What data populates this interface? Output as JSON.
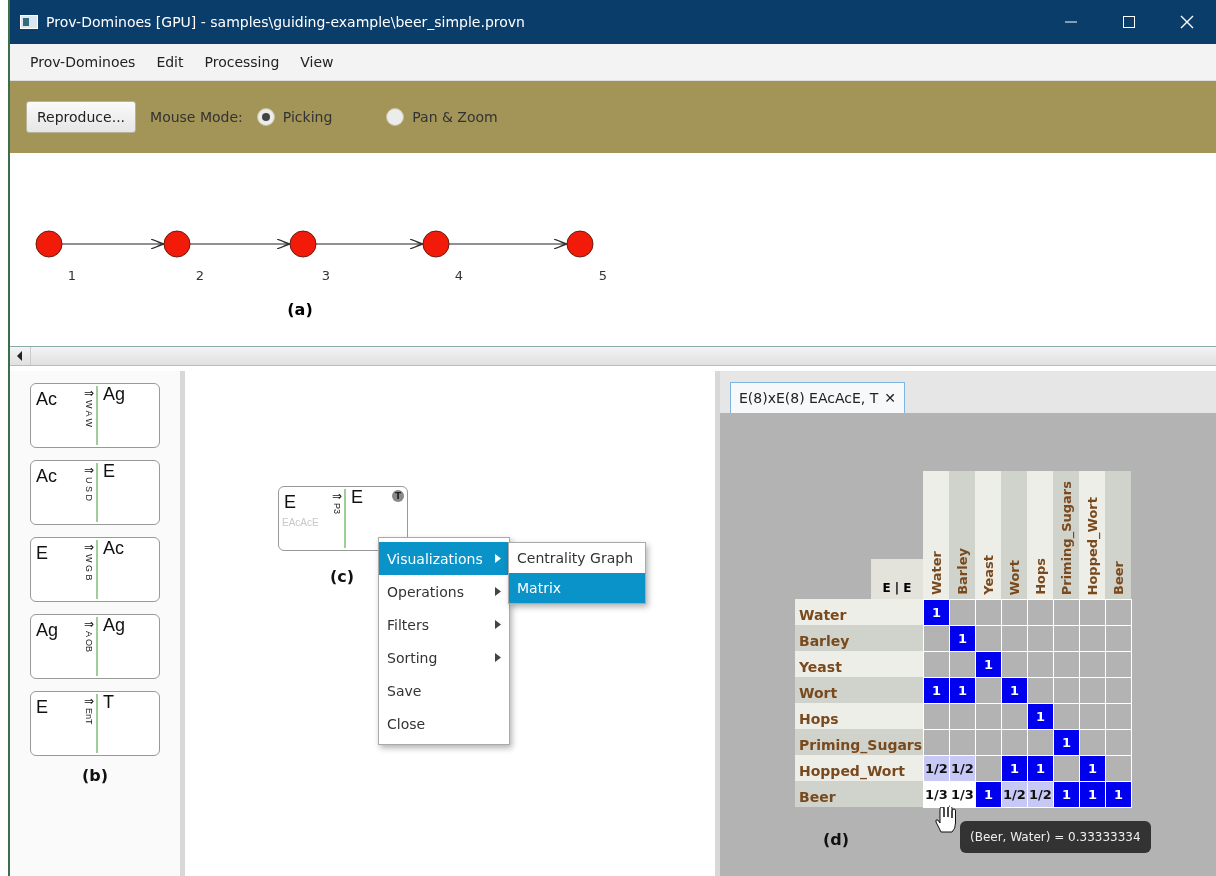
{
  "window": {
    "title": "Prov-Dominoes [GPU] -  samples\\guiding-example\\beer_simple.provn"
  },
  "menu": [
    "Prov-Dominoes",
    "Edit",
    "Processing",
    "View"
  ],
  "toolbar": {
    "button": "Reproduce...",
    "mouse_mode_label": "Mouse Mode:",
    "modes": [
      {
        "label": "Picking",
        "selected": true
      },
      {
        "label": "Pan & Zoom",
        "selected": false
      }
    ]
  },
  "graph": {
    "nodes": [
      "1",
      "2",
      "3",
      "4",
      "5"
    ],
    "caption": "(a)"
  },
  "dominoes": [
    {
      "left": "Ac",
      "arrow": "⇒",
      "relation": "W A W",
      "right": "Ag"
    },
    {
      "left": "Ac",
      "arrow": "⇒",
      "relation": "U S D",
      "right": "E"
    },
    {
      "left": "E",
      "arrow": "⇒",
      "relation": "W G B",
      "right": "Ac"
    },
    {
      "left": "Ag",
      "arrow": "⇒",
      "relation": "A OB",
      "right": "Ag"
    },
    {
      "left": "E",
      "arrow": "⇒",
      "relation": "EnT",
      "right": "T"
    }
  ],
  "dominoes_caption": "(b)",
  "workspace": {
    "domino": {
      "left": "E",
      "arrow": "⇒",
      "right": "E",
      "path": "EAcAcE",
      "relation": "P3",
      "badge": "T"
    },
    "caption": "(c)",
    "context_menu": [
      {
        "label": "Visualizations",
        "submenu": true,
        "selected": true
      },
      {
        "label": "Operations",
        "submenu": true,
        "selected": false
      },
      {
        "label": "Filters",
        "submenu": true,
        "selected": false
      },
      {
        "label": "Sorting",
        "submenu": true,
        "selected": false
      },
      {
        "label": "Save",
        "submenu": false,
        "selected": false
      },
      {
        "label": "Close",
        "submenu": false,
        "selected": false
      }
    ],
    "submenu": [
      {
        "label": "Centrality Graph",
        "selected": false
      },
      {
        "label": "Matrix",
        "selected": true
      }
    ]
  },
  "matrix_view": {
    "tab": {
      "label": "E(8)xE(8) EAcAcE, T",
      "close": "✕"
    },
    "corner": "E | E",
    "columns": [
      "Water",
      "Barley",
      "Yeast",
      "Wort",
      "Hops",
      "Priming_Sugars",
      "Hopped_Wort",
      "Beer"
    ],
    "rows": [
      {
        "label": "Water",
        "cells": [
          {
            "value": "1",
            "kind": "full"
          },
          null,
          null,
          null,
          null,
          null,
          null,
          null
        ]
      },
      {
        "label": "Barley",
        "cells": [
          null,
          {
            "value": "1",
            "kind": "full"
          },
          null,
          null,
          null,
          null,
          null,
          null
        ]
      },
      {
        "label": "Yeast",
        "cells": [
          null,
          null,
          {
            "value": "1",
            "kind": "full"
          },
          null,
          null,
          null,
          null,
          null
        ]
      },
      {
        "label": "Wort",
        "cells": [
          {
            "value": "1",
            "kind": "full"
          },
          {
            "value": "1",
            "kind": "full"
          },
          null,
          {
            "value": "1",
            "kind": "full"
          },
          null,
          null,
          null,
          null
        ]
      },
      {
        "label": "Hops",
        "cells": [
          null,
          null,
          null,
          null,
          {
            "value": "1",
            "kind": "full"
          },
          null,
          null,
          null
        ]
      },
      {
        "label": "Priming_Sugars",
        "cells": [
          null,
          null,
          null,
          null,
          null,
          {
            "value": "1",
            "kind": "full"
          },
          null,
          null
        ]
      },
      {
        "label": "Hopped_Wort",
        "cells": [
          {
            "value": "1/2",
            "kind": "partial"
          },
          {
            "value": "1/2",
            "kind": "partial"
          },
          null,
          {
            "value": "1",
            "kind": "full"
          },
          {
            "value": "1",
            "kind": "full"
          },
          null,
          {
            "value": "1",
            "kind": "full"
          },
          null
        ]
      },
      {
        "label": "Beer",
        "cells": [
          {
            "value": "1/3",
            "kind": "light"
          },
          {
            "value": "1/3",
            "kind": "light"
          },
          {
            "value": "1",
            "kind": "full"
          },
          {
            "value": "1/2",
            "kind": "partial"
          },
          {
            "value": "1/2",
            "kind": "partial"
          },
          {
            "value": "1",
            "kind": "full"
          },
          {
            "value": "1",
            "kind": "full"
          },
          {
            "value": "1",
            "kind": "full"
          }
        ]
      }
    ],
    "tooltip": "(Beer, Water) = 0.33333334",
    "caption": "(d)"
  }
}
